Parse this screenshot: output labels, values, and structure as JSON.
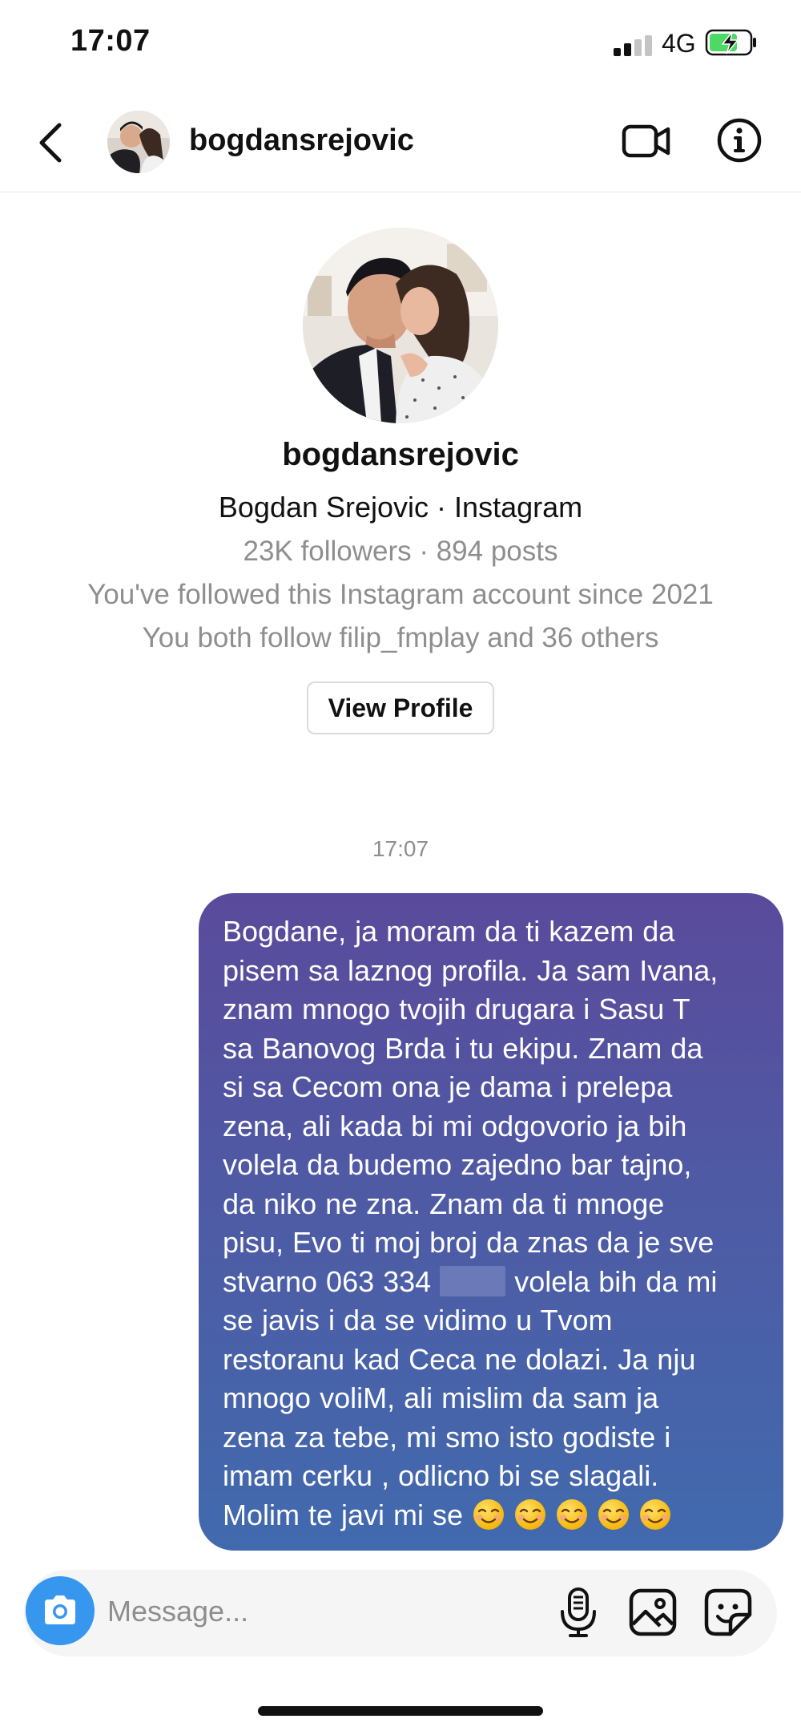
{
  "status_bar": {
    "time": "17:07",
    "network": "4G",
    "signal_bars_active": 2,
    "signal_bars_total": 4,
    "battery_state": "charging"
  },
  "header": {
    "username": "bogdansrejovic"
  },
  "profile": {
    "username": "bogdansrejovic",
    "name_line": "Bogdan Srejovic · Instagram",
    "stats": "23K followers · 894 posts",
    "followed_since": "You've followed this Instagram account since 2021",
    "mutual": "You both follow filip_fmplay and 36 others",
    "view_profile_label": "View Profile"
  },
  "thread": {
    "timestamp": "17:07",
    "message": {
      "text_before_redaction": "Bogdane, ja moram da ti kazem da\npisem sa laznog profila. Ja sam Ivana,\nznam mnogo tvojih drugara i Sasu T\nsa Banovog Brda i tu ekipu. Znam da\nsi sa Cecom ona je dama i prelepa\nzena, ali kada bi mi odgovorio ja bih\nvolela da budemo zajedno bar tajno,\nda niko ne zna. Znam da ti mnoge\npisu, Evo ti moj broj da znas da je sve\nstvarno 063 334 ",
      "text_after_redaction": " volela bih da mi\nse javis i da se vidimo u Tvom\nrestoranu kad Ceca ne dolazi. Ja nju\nmnogo voliM, ali mislim da sam ja\nzena za tebe, mi smo isto godiste i\nimam cerku , odlicno bi se slagali.\nMolim te javi mi se ",
      "emoji_name": "smiling-face",
      "emoji_count": 5
    }
  },
  "composer": {
    "placeholder": "Message..."
  },
  "colors": {
    "accent_blue": "#3797ef",
    "bubble_top": "#5a4a9c",
    "bubble_bottom": "#416aae",
    "muted_text": "#8e8e8e",
    "battery_green": "#4cd964"
  }
}
